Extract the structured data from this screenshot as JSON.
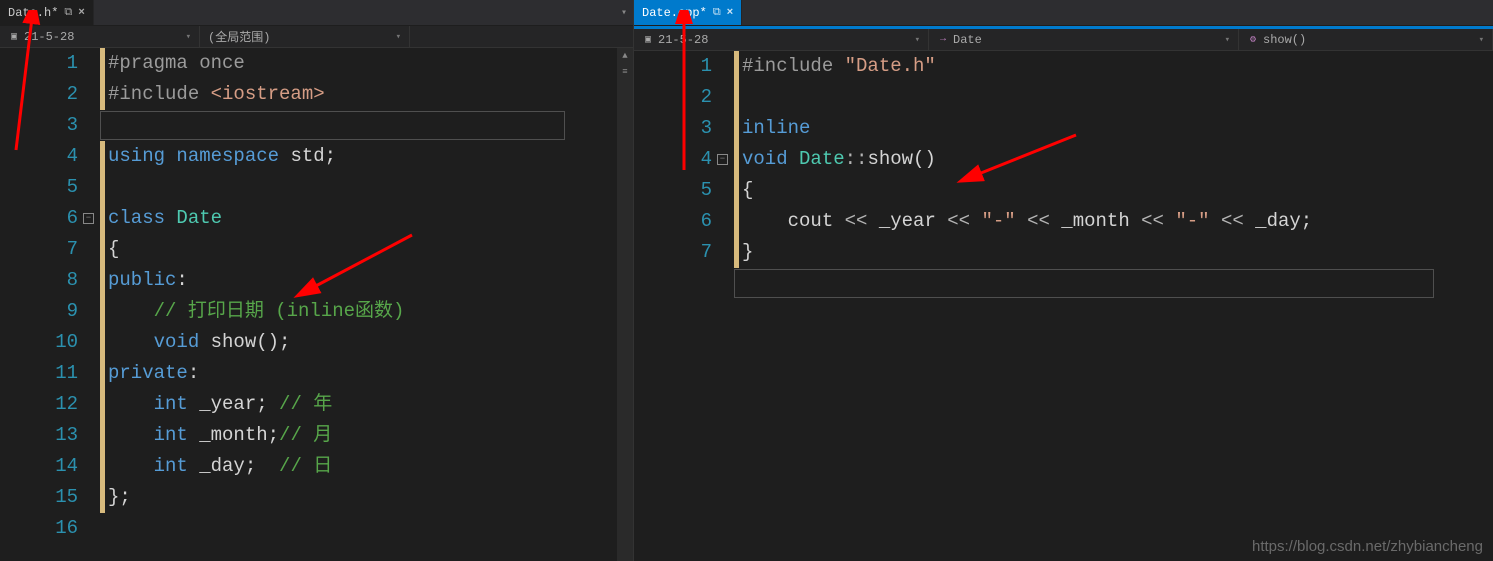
{
  "left": {
    "tab": {
      "title": "Date.h*",
      "pin": "⧉",
      "close": "×"
    },
    "nav": {
      "scope1": {
        "icon": "⬚",
        "text": "21-5-28"
      },
      "scope2": {
        "text": "(全局范围)"
      }
    },
    "lines": [
      "1",
      "2",
      "3",
      "4",
      "5",
      "6",
      "7",
      "8",
      "9",
      "10",
      "11",
      "12",
      "13",
      "14",
      "15",
      "16"
    ],
    "code": {
      "l1_a": "#pragma",
      "l1_b": " once",
      "l2_a": "#include",
      "l2_b": " <iostream>",
      "l3": "",
      "l4_a": "using",
      "l4_b": " namespace",
      "l4_c": " std",
      "l4_d": ";",
      "l5": "",
      "l6_a": "class",
      "l6_b": " Date",
      "l7": "{",
      "l8_a": "public",
      "l8_b": ":",
      "l9_a": "    ",
      "l9_b": "// 打印日期 (inline函数)",
      "l10_a": "    ",
      "l10_b": "void",
      "l10_c": " show();",
      "l11_a": "private",
      "l11_b": ":",
      "l12_a": "    ",
      "l12_b": "int",
      "l12_c": " _year; ",
      "l12_d": "// 年",
      "l13_a": "    ",
      "l13_b": "int",
      "l13_c": " _month;",
      "l13_d": "// 月",
      "l14_a": "    ",
      "l14_b": "int",
      "l14_c": " _day;  ",
      "l14_d": "// 日",
      "l15": "};",
      "l16": ""
    }
  },
  "right": {
    "tab": {
      "title": "Date.cpp*",
      "pin": "⧉",
      "close": "×"
    },
    "nav": {
      "scope1": {
        "icon": "⬚",
        "text": "21-5-28"
      },
      "scope2": {
        "icon": "→",
        "text": "Date"
      },
      "scope3": {
        "icon": "⚙",
        "text": "show()"
      }
    },
    "lines": [
      "1",
      "2",
      "3",
      "4",
      "5",
      "6",
      "7"
    ],
    "code": {
      "l1_a": "#include",
      "l1_b": " \"Date.h\"",
      "l2": "",
      "l3_a": "inline",
      "l4_a": "void",
      "l4_b": " Date",
      "l4_c": "::",
      "l4_d": "show",
      "l4_e": "()",
      "l5": "{",
      "l6_a": "    cout ",
      "l6_b": "<<",
      "l6_c": " _year ",
      "l6_d": "<<",
      "l6_e": " \"-\"",
      "l6_f": " <<",
      "l6_g": " _month ",
      "l6_h": "<<",
      "l6_i": " \"-\"",
      "l6_j": " <<",
      "l6_k": " _day;",
      "l7": "}"
    }
  },
  "watermark": "https://blog.csdn.net/zhybiancheng"
}
